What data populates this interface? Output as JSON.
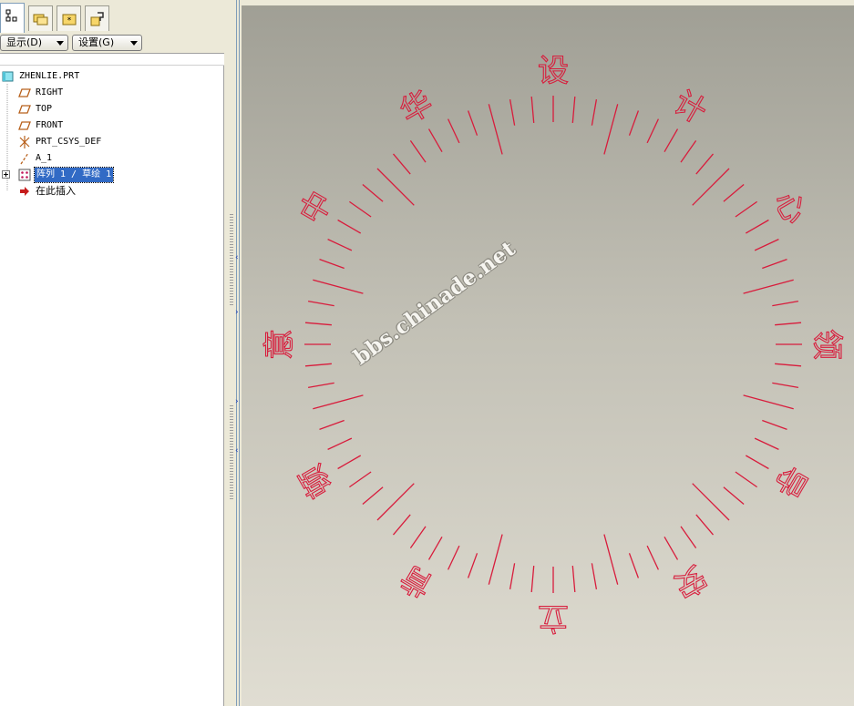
{
  "tabs": [
    {
      "icon": "model-tree-icon",
      "active": true
    },
    {
      "icon": "folder-browser-icon",
      "active": false
    },
    {
      "icon": "favorites-icon",
      "active": false
    },
    {
      "icon": "connections-icon",
      "active": false
    }
  ],
  "toolbar": {
    "show_label": "显示(D)",
    "settings_label": "设置(G)"
  },
  "tree": {
    "items": [
      {
        "label": "ZHENLIE.PRT",
        "icon": "part-icon",
        "selected": false,
        "expandable": false
      },
      {
        "label": "RIGHT",
        "icon": "datum-plane-icon",
        "selected": false,
        "expandable": false
      },
      {
        "label": "TOP",
        "icon": "datum-plane-icon",
        "selected": false,
        "expandable": false
      },
      {
        "label": "FRONT",
        "icon": "datum-plane-icon",
        "selected": false,
        "expandable": false
      },
      {
        "label": "PRT_CSYS_DEF",
        "icon": "coordinate-system-icon",
        "selected": false,
        "expandable": false
      },
      {
        "label": "A_1",
        "icon": "datum-axis-icon",
        "selected": false,
        "expandable": false
      },
      {
        "label": "阵列 1 / 草绘 1",
        "icon": "pattern-icon",
        "selected": true,
        "expandable": true
      },
      {
        "label": "在此插入",
        "icon": "insert-here-arrow-icon",
        "selected": false,
        "expandable": false
      }
    ]
  },
  "dial": {
    "characters": [
      "中",
      "华",
      "设",
      "计",
      "心",
      "领",
      "导",
      "安",
      "立",
      "肯",
      "顿",
      "意"
    ],
    "total_ticks": 72,
    "major_every": 6,
    "line_color": "#d81c3c"
  },
  "watermark": "bbs.chinade.net"
}
